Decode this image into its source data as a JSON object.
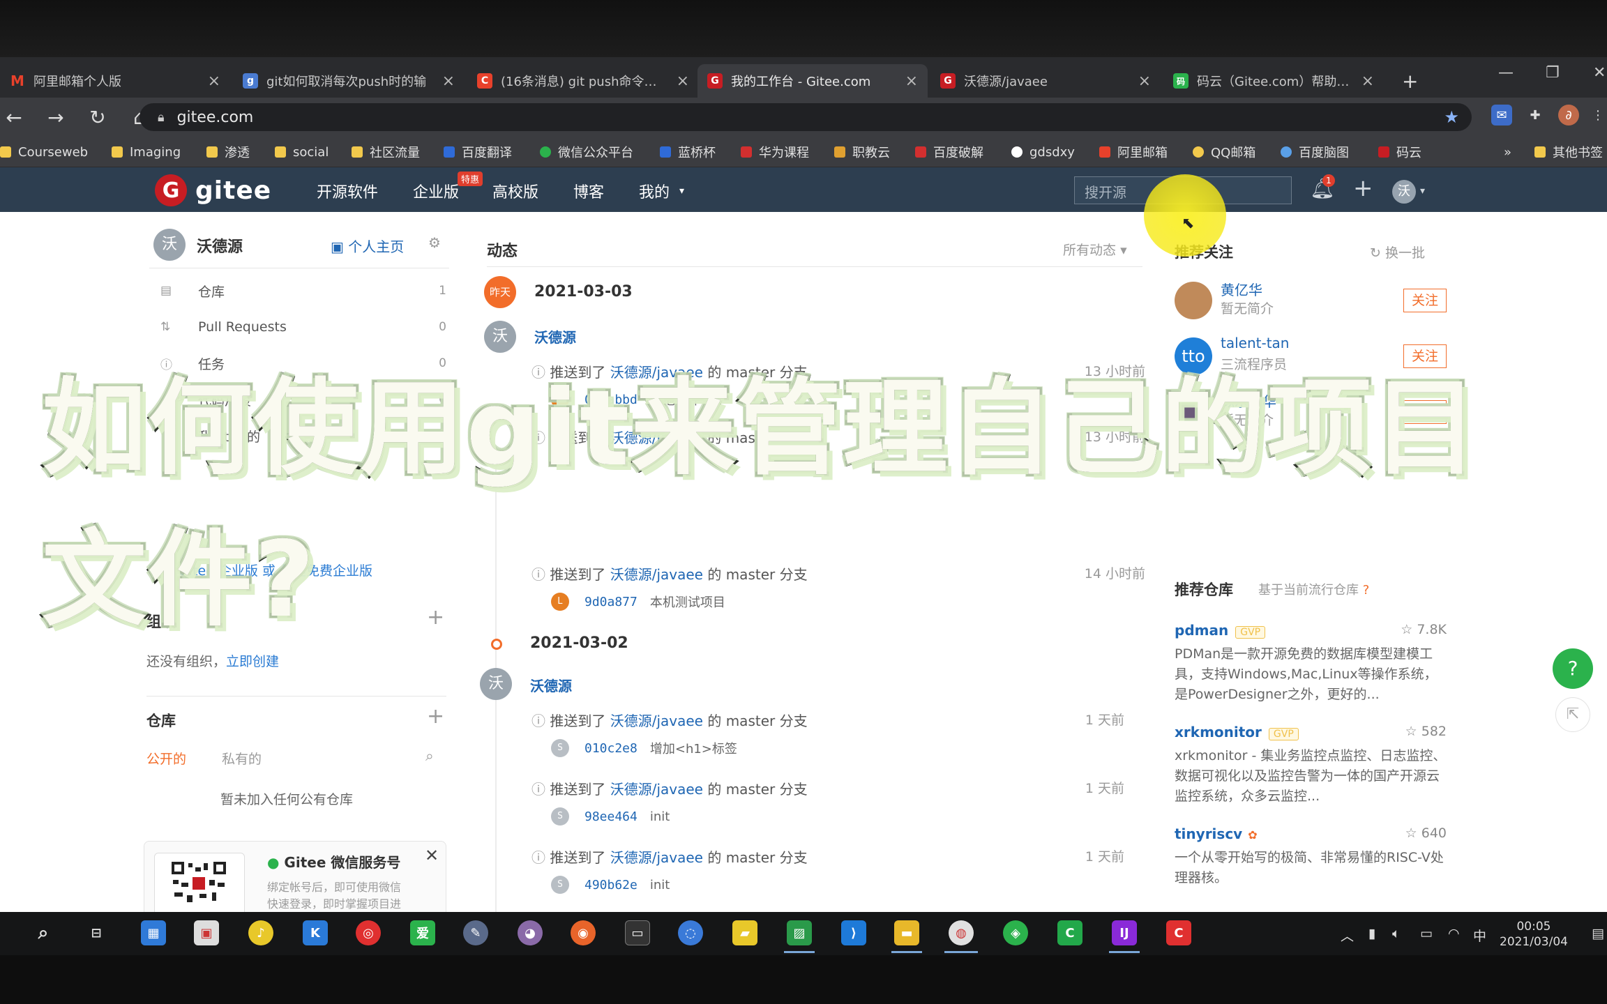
{
  "overlay_title": "如何使用git来管理自己的项目文件?",
  "browser": {
    "tabs": [
      {
        "title": "阿里邮箱个人版",
        "color": "#e8412b",
        "glyph": "M"
      },
      {
        "title": "git如何取消每次push时的输",
        "color": "#4a7bd1",
        "glyph": "g"
      },
      {
        "title": "(16条消息) git push命令不用",
        "color": "#e8412b",
        "glyph": "C"
      },
      {
        "title": "我的工作台 - Gitee.com",
        "color": "#c71d23",
        "glyph": "G"
      },
      {
        "title": "沃德源/javaee",
        "color": "#c71d23",
        "glyph": "G"
      },
      {
        "title": "码云（Gitee.com）帮助文档",
        "color": "#2bb24c",
        "glyph": "码"
      }
    ],
    "url": "gitee.com",
    "bookmarks": [
      {
        "label": "Courseweb",
        "color": "#f2c94c"
      },
      {
        "label": "Imaging",
        "color": "#f2c94c"
      },
      {
        "label": "渗透",
        "color": "#f2c94c"
      },
      {
        "label": "social",
        "color": "#f2c94c"
      },
      {
        "label": "社区流量",
        "color": "#f2c94c"
      },
      {
        "label": "百度翻译",
        "color": "#2f6bd8"
      },
      {
        "label": "微信公众平台",
        "color": "#2bb24c"
      },
      {
        "label": "蓝桥杯",
        "color": "#2f6bd8"
      },
      {
        "label": "华为课程",
        "color": "#d32f2f"
      },
      {
        "label": "职教云",
        "color": "#e0a030"
      },
      {
        "label": "百度破解",
        "color": "#d32f2f"
      },
      {
        "label": "gdsdxy",
        "color": "#ffffff"
      },
      {
        "label": "阿里邮箱",
        "color": "#e8412b"
      },
      {
        "label": "QQ邮箱",
        "color": "#f2c94c"
      },
      {
        "label": "百度脑图",
        "color": "#5aa0e8"
      },
      {
        "label": "码云",
        "color": "#c71d23"
      }
    ],
    "bookmarks_more": "»",
    "other_bookmarks": "其他书签"
  },
  "gitee": {
    "brand": "gitee",
    "nav": [
      "开源软件",
      "企业版",
      "高校版",
      "博客",
      "我的"
    ],
    "hot_badge": "特惠",
    "search_placeholder": "搜开源",
    "notification_count": "1",
    "user_initial": "沃"
  },
  "sidebar": {
    "user_initial": "沃",
    "user_name": "沃德源",
    "home_link": "个人主页",
    "items": [
      {
        "label": "仓库",
        "count": "1",
        "icon": "repo-icon"
      },
      {
        "label": "Pull Requests",
        "count": "0",
        "icon": "pr-icon"
      },
      {
        "label": "任务",
        "count": "0",
        "icon": "issue-icon"
      },
      {
        "label": "代码片段",
        "count": "0",
        "icon": "code-icon"
      },
      {
        "label": "我 Star 的",
        "count": "0",
        "icon": "star-icon"
      }
    ],
    "enterprise_text": "了解 Gitee 企业版 或 创建免费企业版",
    "org_title": "组织",
    "org_empty": "还没有组织，",
    "org_create": "立即创建",
    "repo_title": "仓库",
    "repo_tab_public": "公开的",
    "repo_tab_private": "私有的",
    "repo_empty": "暂未加入任何公有仓库",
    "wechat_title": "Gitee 微信服务号",
    "wechat_desc1": "绑定帐号后，即可使用微信",
    "wechat_desc2": "快速登录，即时掌握项目进"
  },
  "feed": {
    "title": "动态",
    "filter": "所有动态",
    "days": [
      {
        "badge": "昨天",
        "date": "2021-03-03"
      },
      {
        "badge": "",
        "date": "2021-03-02"
      }
    ],
    "user": "沃德源",
    "user_initial": "沃",
    "push_prefix": "推送到了",
    "repo": "沃德源/javaee",
    "branch_text": "的 master 分支",
    "events": [
      {
        "time": "13 小时前",
        "sha": "09dabbd",
        "msg": "其他文件",
        "avatar": "L",
        "ac": "#e67e22"
      },
      {
        "time": "13 小时前",
        "sha": "",
        "msg": "",
        "avatar": "",
        "ac": ""
      },
      {
        "time": "14 小时前",
        "sha": "9d0a877",
        "msg": "本机测试项目",
        "avatar": "L",
        "ac": "#e67e22"
      },
      {
        "time": "1 天前",
        "sha": "010c2e8",
        "msg": "增加<h1>标签",
        "avatar": "S",
        "ac": "#b8bec4"
      },
      {
        "time": "1 天前",
        "sha": "98ee464",
        "msg": "init",
        "avatar": "S",
        "ac": "#b8bec4"
      },
      {
        "time": "1 天前",
        "sha": "490b62e",
        "msg": "init",
        "avatar": "S",
        "ac": "#b8bec4"
      }
    ]
  },
  "recommend": {
    "title": "推荐关注",
    "refresh": "换一批",
    "follow_label": "关注",
    "users": [
      {
        "name": "黄亿华",
        "desc": "暂无简介",
        "color": "#c08a5a"
      },
      {
        "name": "talent-tan",
        "desc": "三流程序员",
        "color": "#1f7fd8"
      },
      {
        "name": "似水年华",
        "desc": "暂无简介",
        "color": "#6b5a7a"
      }
    ],
    "repos_title": "推荐仓库",
    "repos_sub": "基于当前流行仓库",
    "repos": [
      {
        "name": "pdman",
        "gvp": "GVP",
        "stars": "7.8K",
        "desc": "PDMan是一款开源免费的数据库模型建模工具，支持Windows,Mac,Linux等操作系统，是PowerDesigner之外，更好的..."
      },
      {
        "name": "xrkmonitor",
        "gvp": "GVP",
        "stars": "582",
        "desc": "xrkmonitor - 集业务监控点监控、日志监控、数据可视化以及监控告警为一体的国产开源云监控系统，众多云监控..."
      },
      {
        "name": "tinyriscv",
        "gvp": "",
        "stars": "640",
        "desc": "一个从零开始写的极简、非常易懂的RISC-V处理器核。"
      }
    ]
  },
  "taskbar": {
    "time": "00:05",
    "date": "2021/03/04",
    "ime": "中"
  }
}
